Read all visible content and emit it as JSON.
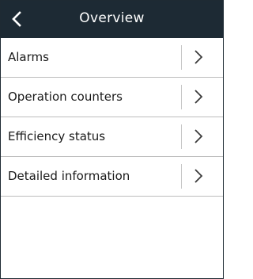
{
  "header": {
    "title": "Overview",
    "back_icon": "chevron-left-icon"
  },
  "menu": {
    "items": [
      {
        "label": "Alarms",
        "icon": "chevron-right-icon"
      },
      {
        "label": "Operation counters",
        "icon": "chevron-right-icon"
      },
      {
        "label": "Efficiency status",
        "icon": "chevron-right-icon"
      },
      {
        "label": "Detailed information",
        "icon": "chevron-right-icon"
      }
    ]
  },
  "colors": {
    "header_bg": "#1d2a34",
    "header_text": "#ffffff",
    "divider": "#bdbdbd"
  }
}
